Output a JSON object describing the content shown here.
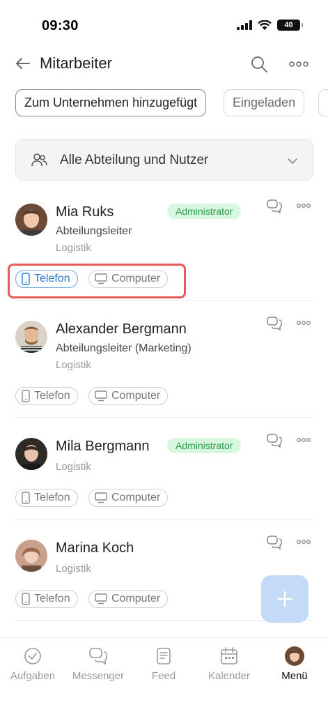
{
  "status": {
    "time": "09:30",
    "battery": "40"
  },
  "header": {
    "title": "Mitarbeiter"
  },
  "filters": [
    {
      "label": "Zum Unternehmen hinzugefügt"
    },
    {
      "label": "Eingeladen"
    }
  ],
  "department_select": {
    "label": "Alle Abteilung und Nutzer"
  },
  "employees": [
    {
      "name": "Mia Ruks",
      "position": "Abteilungsleiter",
      "department": "Logistik",
      "badge": "Administrator",
      "phone": "Telefon",
      "computer": "Computer"
    },
    {
      "name": "Alexander Bergmann",
      "position": "Abteilungsleiter (Marketing)",
      "department": "Logistik",
      "phone": "Telefon",
      "computer": "Computer"
    },
    {
      "name": "Mila Bergmann",
      "department": "Logistik",
      "badge": "Administrator",
      "phone": "Telefon",
      "computer": "Computer"
    },
    {
      "name": "Marina Koch",
      "department": "Logistik",
      "phone": "Telefon",
      "computer": "Computer"
    }
  ],
  "tabs": [
    {
      "label": "Aufgaben",
      "icon": "check-circle-icon"
    },
    {
      "label": "Messenger",
      "icon": "chat-icon"
    },
    {
      "label": "Feed",
      "icon": "feed-icon"
    },
    {
      "label": "Kalender",
      "icon": "calendar-icon"
    },
    {
      "label": "Menü",
      "icon": "avatar"
    }
  ],
  "colors": {
    "badge_bg": "#d8f7df",
    "badge_text": "#2e9b4b",
    "active_device": "#2a7bd3",
    "highlight": "#e85a5a",
    "fab": "#c3dbf6"
  }
}
